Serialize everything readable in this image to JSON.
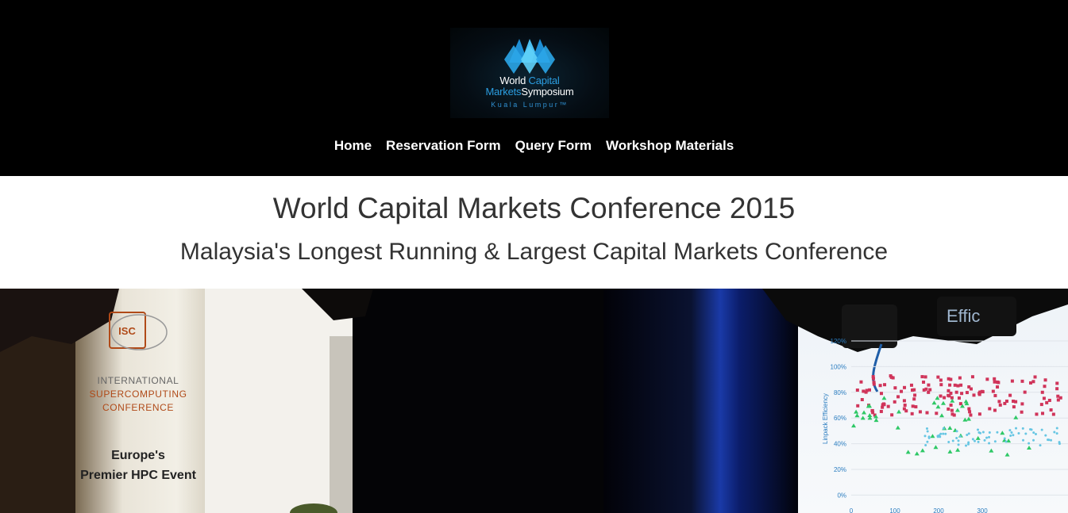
{
  "header": {
    "logo": {
      "line1_part1": "World",
      "line1_part2": "Capital",
      "line2_part1": "Markets",
      "line2_part2": "Symposium",
      "line3": "Kuala Lumpur™"
    },
    "nav": [
      {
        "label": "Home"
      },
      {
        "label": "Reservation Form"
      },
      {
        "label": "Query Form"
      },
      {
        "label": "Workshop Materials"
      }
    ]
  },
  "main": {
    "title": "World Capital Markets Conference 2015",
    "subtitle": "Malaysia's Longest Running & Largest Capital Markets Conference"
  },
  "hero": {
    "banner": {
      "logo_text": "ISC",
      "org_line1": "INTERNATIONAL",
      "org_line2": "SUPERCOMPUTING",
      "org_line3": "CONFERENCE",
      "tagline_line1": "Europe's",
      "tagline_line2": "Premier HPC Event"
    },
    "screen": {
      "title_fragment": "Effic",
      "ylabel": "Linpack Efficiency",
      "yticks": [
        "120%",
        "100%",
        "80%",
        "60%",
        "40%",
        "20%",
        "0%"
      ],
      "xticks": [
        "0",
        "100",
        "200",
        "300"
      ]
    }
  },
  "colors": {
    "header_bg": "#000000",
    "nav_text": "#ffffff",
    "title_text": "#333333",
    "logo_blue": "#2b9de0",
    "chart_red": "#d0345a",
    "chart_green": "#2ec866",
    "chart_cyan": "#67c6e3"
  }
}
